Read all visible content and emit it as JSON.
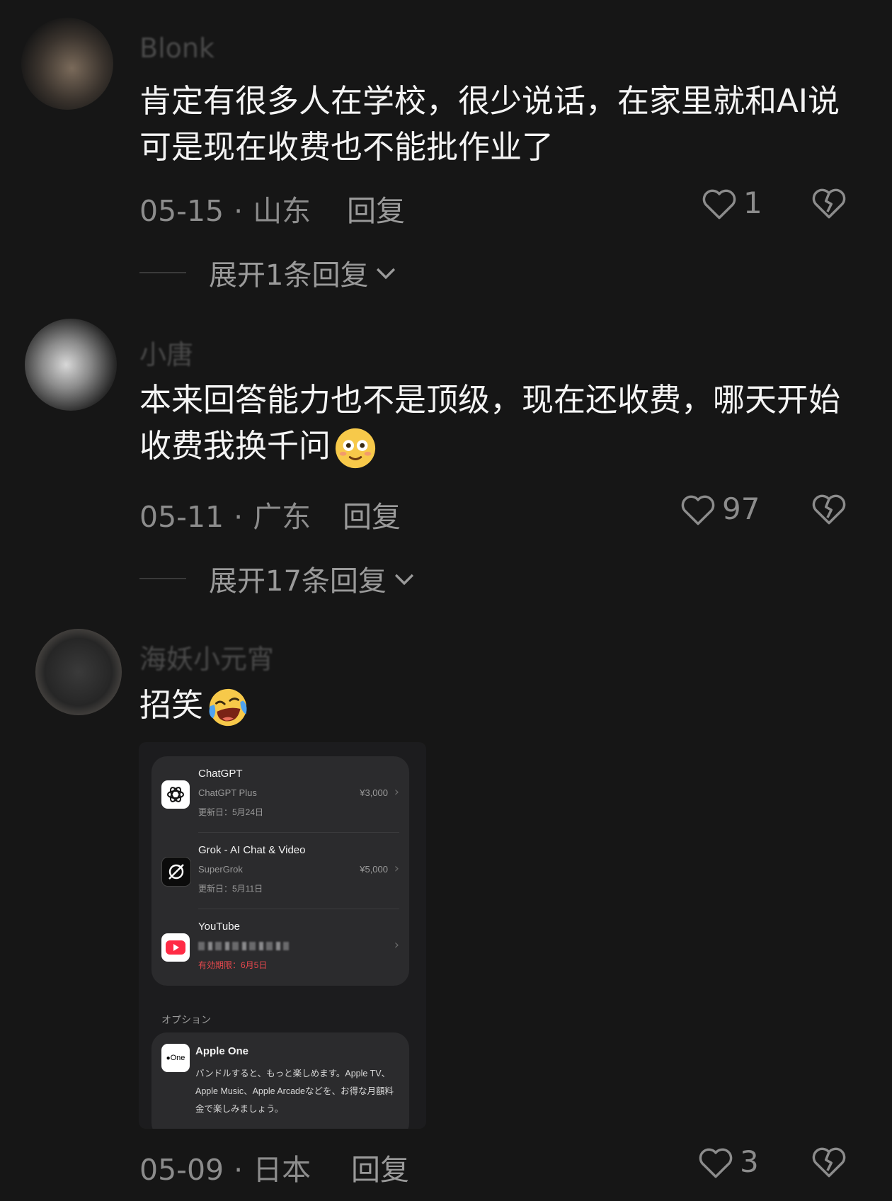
{
  "comments": [
    {
      "username": "Blonk",
      "text": "肯定有很多人在学校，很少说话，在家里就和AI说 可是现在收费也不能批作业了",
      "date": "05-15",
      "location": "山东",
      "reply_label": "回复",
      "likes": "1",
      "expand_label": "展开1条回复"
    },
    {
      "username": "小唐",
      "text": "本来回答能力也不是顶级，现在还收费，哪天开始收费我换千问",
      "emoji": "smiling-flushed-emoji",
      "date": "05-11",
      "location": "广东",
      "reply_label": "回复",
      "likes": "97",
      "expand_label": "展开17条回复"
    },
    {
      "username": "海妖小元宵",
      "text": "招笑",
      "emoji": "crying-laughing-emoji",
      "date": "05-09",
      "location": "日本",
      "reply_label": "回复",
      "likes": "3"
    }
  ],
  "attached_screenshot": {
    "subscriptions": [
      {
        "name": "ChatGPT",
        "plan": "ChatGPT Plus",
        "price": "¥3,000",
        "date": "更新日：5月24日",
        "icon": "chatgpt-logo-icon"
      },
      {
        "name": "Grok - AI Chat & Video",
        "plan": "SuperGrok",
        "price": "¥5,000",
        "date": "更新日：5月11日",
        "icon": "grok-logo-icon"
      },
      {
        "name": "YouTube",
        "plan": "",
        "date": "有効期限：6月5日",
        "icon": "youtube-logo-icon",
        "date_color": "#e5484d"
      }
    ],
    "options_header": "オプション",
    "apple_one": {
      "title": "Apple One",
      "icon_text": "One",
      "description": "バンドルすると、もっと楽しめます。Apple TV、Apple Music、Apple Arcadeなどを、お得な月額料金で楽しみましょう。"
    }
  },
  "colors": {
    "background": "#161616",
    "text_primary": "#f4f4f4",
    "text_secondary": "#8c8c8c",
    "alert_red": "#e5484d"
  }
}
